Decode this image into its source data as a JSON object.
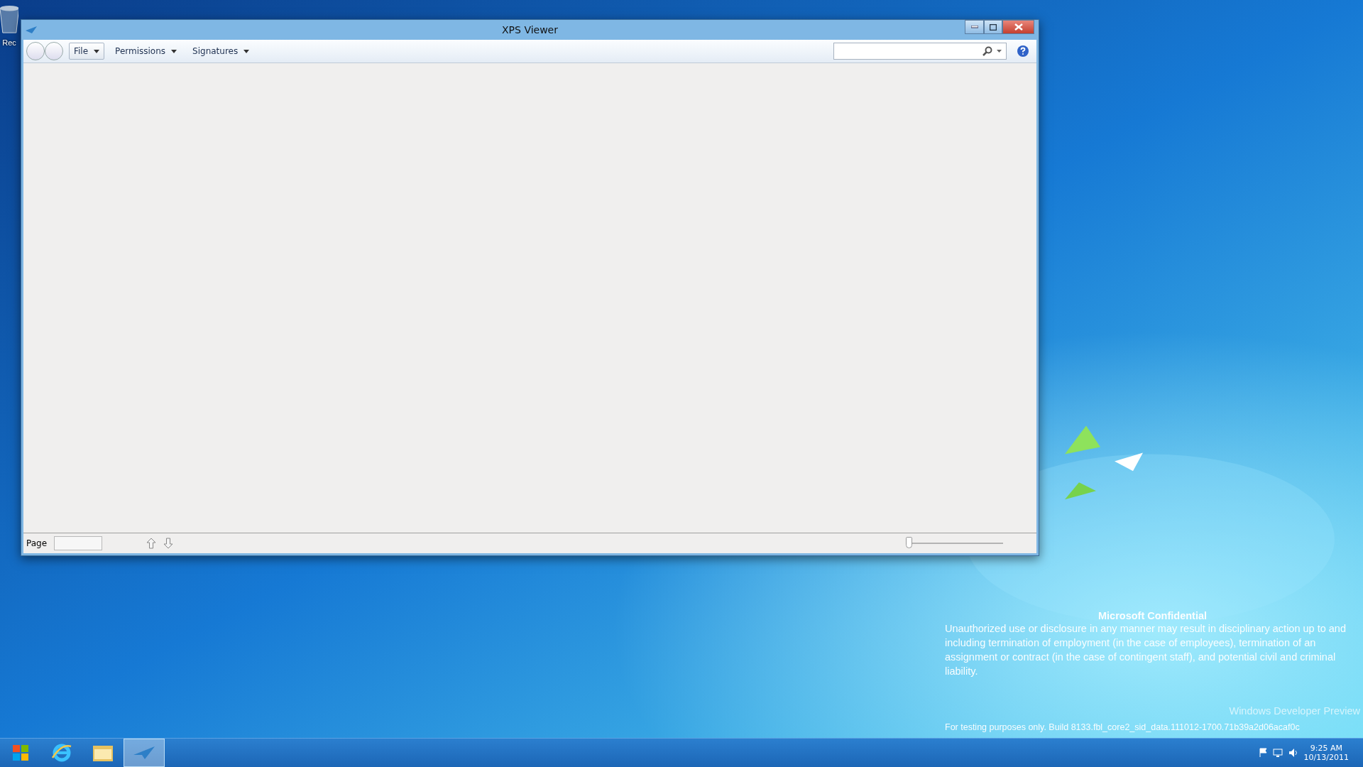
{
  "desktop": {
    "icons": [
      {
        "label": "Rec"
      }
    ],
    "notice": {
      "title": "Microsoft Confidential",
      "body": "Unauthorized use or disclosure in any manner may result in disciplinary action up to and including termination of employment (in the case of employees), termination of an assignment or contract (in the case of contingent staff), and potential civil and criminal liability.",
      "edition": "Windows Developer Preview",
      "build": "For testing purposes only. Build 8133.fbl_core2_sid_data.111012-1700.71b39a2d06acaf0c"
    }
  },
  "window": {
    "title": "XPS Viewer"
  },
  "toolbar": {
    "menus": [
      {
        "label": "File",
        "kind": "split"
      },
      {
        "label": "Permissions",
        "kind": "menu"
      },
      {
        "label": "Signatures",
        "kind": "menu"
      }
    ]
  },
  "status_bar": {
    "page_label": "Page",
    "zoom": {
      "level": 0.02
    }
  },
  "taskbar": {
    "apps": [
      {
        "kind": "browser",
        "selected": false
      },
      {
        "kind": "folder",
        "selected": false
      },
      {
        "kind": "viewer",
        "selected": true
      }
    ],
    "clock": {
      "time": "9:25 AM",
      "date": "10/13/2011"
    }
  }
}
